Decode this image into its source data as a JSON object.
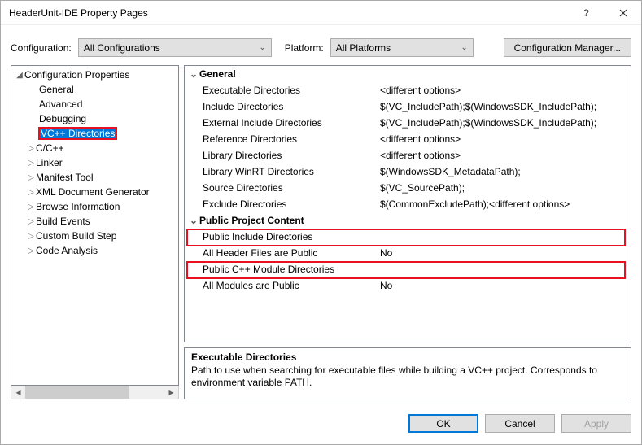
{
  "title": "HeaderUnit-IDE Property Pages",
  "config": {
    "label": "Configuration:",
    "value": "All Configurations",
    "platform_label": "Platform:",
    "platform_value": "All Platforms",
    "manager": "Configuration Manager..."
  },
  "tree": {
    "root": "Configuration Properties",
    "items": [
      {
        "label": "General",
        "arrow": ""
      },
      {
        "label": "Advanced",
        "arrow": ""
      },
      {
        "label": "Debugging",
        "arrow": ""
      },
      {
        "label": "VC++ Directories",
        "arrow": "",
        "selected": true
      },
      {
        "label": "C/C++",
        "arrow": "▹"
      },
      {
        "label": "Linker",
        "arrow": "▹"
      },
      {
        "label": "Manifest Tool",
        "arrow": "▹"
      },
      {
        "label": "XML Document Generator",
        "arrow": "▹"
      },
      {
        "label": "Browse Information",
        "arrow": "▹"
      },
      {
        "label": "Build Events",
        "arrow": "▹"
      },
      {
        "label": "Custom Build Step",
        "arrow": "▹"
      },
      {
        "label": "Code Analysis",
        "arrow": "▹"
      }
    ]
  },
  "grid": {
    "cat1": "General",
    "props1": [
      {
        "k": "Executable Directories",
        "v": "<different options>"
      },
      {
        "k": "Include Directories",
        "v": "$(VC_IncludePath);$(WindowsSDK_IncludePath);"
      },
      {
        "k": "External Include Directories",
        "v": "$(VC_IncludePath);$(WindowsSDK_IncludePath);"
      },
      {
        "k": "Reference Directories",
        "v": "<different options>"
      },
      {
        "k": "Library Directories",
        "v": "<different options>"
      },
      {
        "k": "Library WinRT Directories",
        "v": "$(WindowsSDK_MetadataPath);"
      },
      {
        "k": "Source Directories",
        "v": "$(VC_SourcePath);"
      },
      {
        "k": "Exclude Directories",
        "v": "$(CommonExcludePath);<different options>"
      }
    ],
    "cat2": "Public Project Content",
    "props2": [
      {
        "k": "Public Include Directories",
        "v": ""
      },
      {
        "k": "All Header Files are Public",
        "v": "No"
      },
      {
        "k": "Public C++ Module Directories",
        "v": ""
      },
      {
        "k": "All Modules are Public",
        "v": "No"
      }
    ]
  },
  "desc": {
    "title": "Executable Directories",
    "text": "Path to use when searching for executable files while building a VC++ project.  Corresponds to environment variable PATH."
  },
  "footer": {
    "ok": "OK",
    "cancel": "Cancel",
    "apply": "Apply"
  }
}
